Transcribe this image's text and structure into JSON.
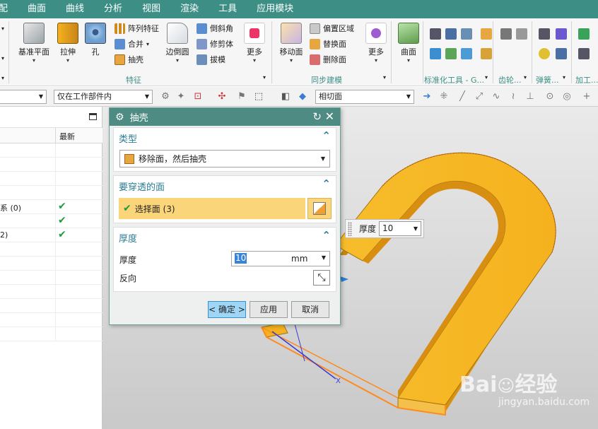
{
  "menubar": {
    "items": [
      "配",
      "曲面",
      "曲线",
      "分析",
      "视图",
      "渲染",
      "工具",
      "应用模块"
    ]
  },
  "ribbon": {
    "feature_buttons": [
      {
        "label": "基准平面",
        "icon": "datum-plane-icon"
      },
      {
        "label": "拉伸",
        "icon": "extrude-icon"
      },
      {
        "label": "孔",
        "icon": "hole-icon"
      }
    ],
    "feature_small": [
      "阵列特征",
      "合并",
      "抽壳"
    ],
    "edge_blend": "边倒圆",
    "feature_small2": [
      "倒斜角",
      "修剪体",
      "拔模"
    ],
    "more1": "更多",
    "feature_group": "特征",
    "move_face": "移动面",
    "sync_small": [
      "偏置区域",
      "替换面",
      "删除面"
    ],
    "more2": "更多",
    "sync_group": "同步建模",
    "surface": "曲面",
    "groups_right": [
      "标准化工具 - G...",
      "齿轮...",
      "弹簧...",
      "加工..."
    ]
  },
  "seltoolbar": {
    "filter_left": "",
    "scope": "仅在工作部件内",
    "face_rule": "相切面"
  },
  "navigator": {
    "col_latest": "最新",
    "rows": [
      {
        "label": "",
        "check": ""
      },
      {
        "label": "",
        "check": ""
      },
      {
        "label": "",
        "check": ""
      },
      {
        "label": "",
        "check": ""
      },
      {
        "label": "系 (0)",
        "check": "✔"
      },
      {
        "label": "",
        "check": "✔"
      },
      {
        "label": "2)",
        "check": "✔"
      },
      {
        "label": "",
        "check": ""
      },
      {
        "label": "",
        "check": ""
      },
      {
        "label": "",
        "check": ""
      },
      {
        "label": "",
        "check": ""
      },
      {
        "label": "",
        "check": ""
      },
      {
        "label": "",
        "check": ""
      },
      {
        "label": "",
        "check": ""
      }
    ]
  },
  "dialog": {
    "title": "抽壳",
    "type_section": {
      "title": "类型",
      "value": "移除面，然后抽壳"
    },
    "face_section": {
      "title": "要穿透的面",
      "select_label": "选择面 (3)"
    },
    "thickness_section": {
      "title": "厚度",
      "thickness_label": "厚度",
      "thickness_value": "10",
      "unit": "mm",
      "reverse_label": "反向"
    },
    "buttons": {
      "ok": "< 确定 >",
      "apply": "应用",
      "cancel": "取消"
    }
  },
  "floating": {
    "label": "厚度",
    "value": "10"
  },
  "colors": {
    "menubar": "#3d8f86",
    "dialog_title": "#4e8b83",
    "part": "#f5b21e",
    "accent": "#2b7d97"
  }
}
